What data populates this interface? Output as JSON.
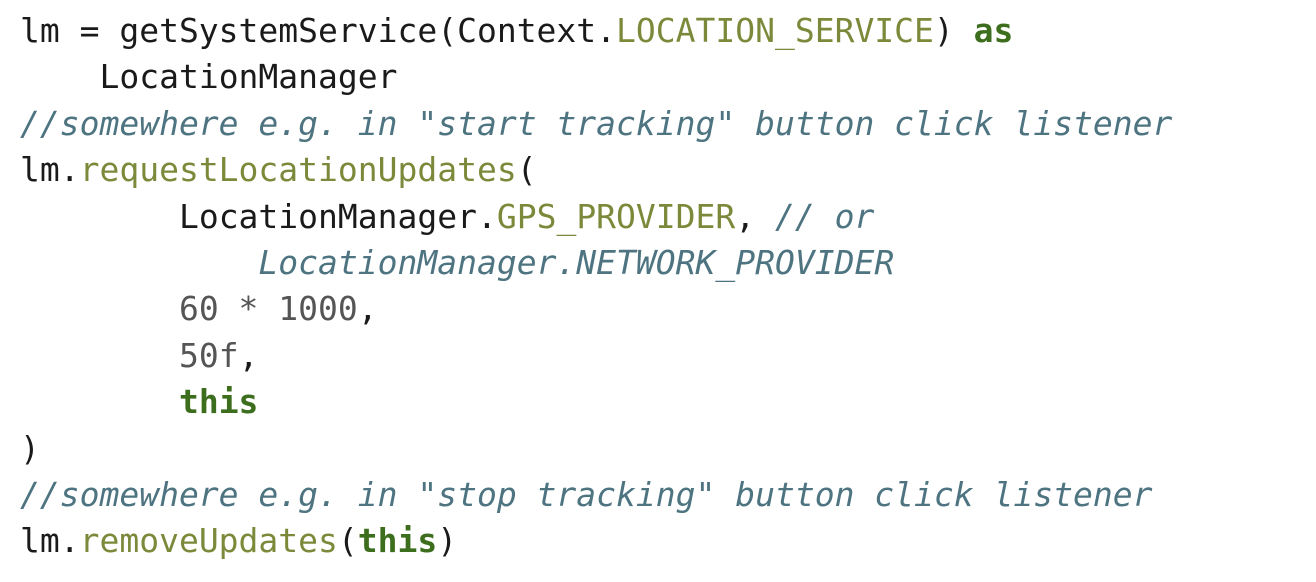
{
  "code": {
    "line1": {
      "a": "lm = getSystemService(Context.",
      "b": "LOCATION_SERVICE",
      "c": ") ",
      "d": "as"
    },
    "line2": {
      "indent": "    ",
      "a": "LocationManager"
    },
    "line3": {
      "comment": "//somewhere e.g. in \"start tracking\" button click listener"
    },
    "line4": {
      "a": "lm.",
      "b": "requestLocationUpdates",
      "c": "("
    },
    "line5": {
      "indent": "        ",
      "a": "LocationManager.",
      "b": "GPS_PROVIDER",
      "c": ", ",
      "comment": "// or"
    },
    "line6": {
      "indent": "            ",
      "comment": "LocationManager.NETWORK_PROVIDER"
    },
    "line7": {
      "indent": "        ",
      "a": "60 * 1000",
      "b": ","
    },
    "line8": {
      "indent": "        ",
      "a": "50f",
      "b": ","
    },
    "line9": {
      "indent": "        ",
      "a": "this"
    },
    "line10": {
      "a": ")"
    },
    "line11": {
      "comment": "//somewhere e.g. in \"stop tracking\" button click listener"
    },
    "line12": {
      "a": "lm.",
      "b": "removeUpdates",
      "c": "(",
      "d": "this",
      "e": ")"
    }
  }
}
